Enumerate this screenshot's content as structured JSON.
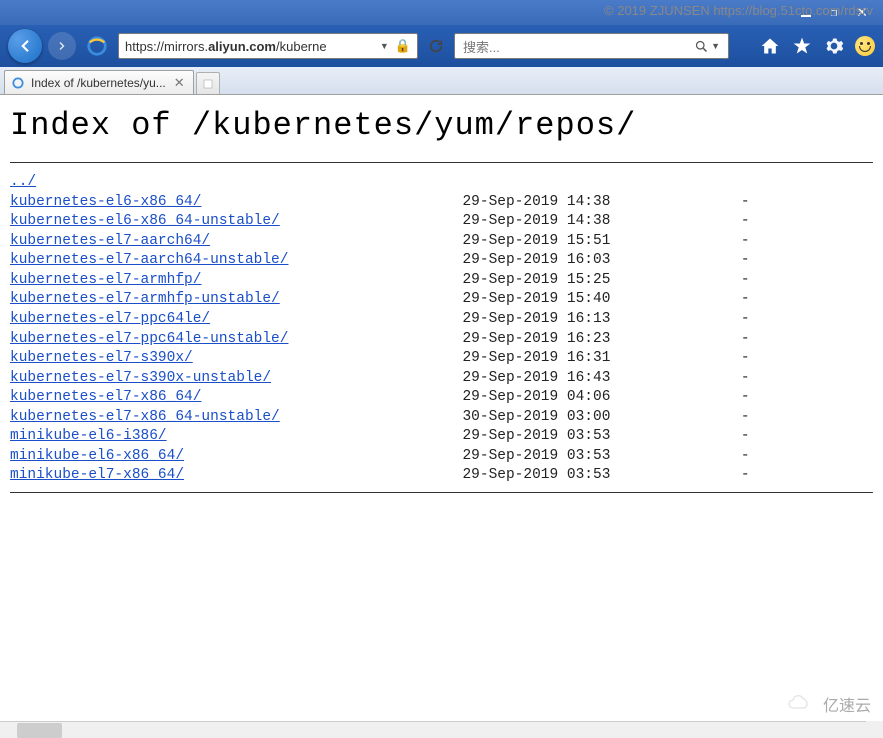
{
  "watermark_top": "© 2019 ZJUNSEN https://blog.51cto.com/rdsrv",
  "watermark_bottom": "亿速云",
  "url_prefix": "https://mirrors.",
  "url_domain": "aliyun.com",
  "url_path": "/kuberne",
  "search_placeholder": "搜索...",
  "tab_title": "Index of /kubernetes/yu...",
  "page_title": "Index of /kubernetes/yum/repos/",
  "parent_link": "../",
  "entries": [
    {
      "name": "kubernetes-el6-x86_64/",
      "date": "29-Sep-2019 14:38",
      "size": "-"
    },
    {
      "name": "kubernetes-el6-x86_64-unstable/",
      "date": "29-Sep-2019 14:38",
      "size": "-"
    },
    {
      "name": "kubernetes-el7-aarch64/",
      "date": "29-Sep-2019 15:51",
      "size": "-"
    },
    {
      "name": "kubernetes-el7-aarch64-unstable/",
      "date": "29-Sep-2019 16:03",
      "size": "-"
    },
    {
      "name": "kubernetes-el7-armhfp/",
      "date": "29-Sep-2019 15:25",
      "size": "-"
    },
    {
      "name": "kubernetes-el7-armhfp-unstable/",
      "date": "29-Sep-2019 15:40",
      "size": "-"
    },
    {
      "name": "kubernetes-el7-ppc64le/",
      "date": "29-Sep-2019 16:13",
      "size": "-"
    },
    {
      "name": "kubernetes-el7-ppc64le-unstable/",
      "date": "29-Sep-2019 16:23",
      "size": "-"
    },
    {
      "name": "kubernetes-el7-s390x/",
      "date": "29-Sep-2019 16:31",
      "size": "-"
    },
    {
      "name": "kubernetes-el7-s390x-unstable/",
      "date": "29-Sep-2019 16:43",
      "size": "-"
    },
    {
      "name": "kubernetes-el7-x86_64/",
      "date": "29-Sep-2019 04:06",
      "size": "-"
    },
    {
      "name": "kubernetes-el7-x86_64-unstable/",
      "date": "30-Sep-2019 03:00",
      "size": "-"
    },
    {
      "name": "minikube-el6-i386/",
      "date": "29-Sep-2019 03:53",
      "size": "-"
    },
    {
      "name": "minikube-el6-x86_64/",
      "date": "29-Sep-2019 03:53",
      "size": "-"
    },
    {
      "name": "minikube-el7-x86_64/",
      "date": "29-Sep-2019 03:53",
      "size": "-"
    }
  ]
}
